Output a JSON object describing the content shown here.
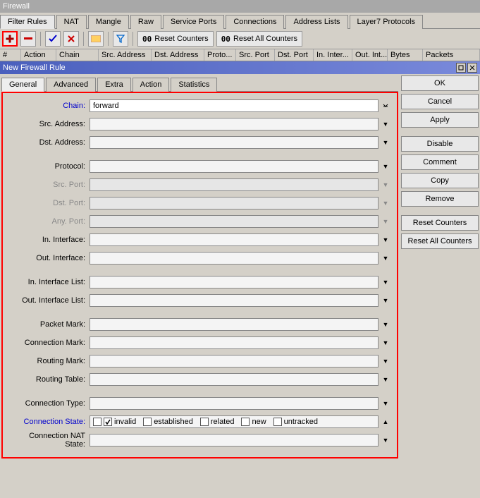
{
  "window_title": "Firewall",
  "main_tabs": [
    "Filter Rules",
    "NAT",
    "Mangle",
    "Raw",
    "Service Ports",
    "Connections",
    "Address Lists",
    "Layer7 Protocols"
  ],
  "toolbar": {
    "reset_counters": "Reset Counters",
    "reset_all_counters": "Reset All Counters"
  },
  "columns": [
    "#",
    "Action",
    "Chain",
    "Src. Address",
    "Dst. Address",
    "Proto...",
    "Src. Port",
    "Dst. Port",
    "In. Inter...",
    "Out. Int...",
    "Bytes",
    "Packets"
  ],
  "dialog": {
    "title": "New Firewall Rule",
    "tabs": [
      "General",
      "Advanced",
      "Extra",
      "Action",
      "Statistics"
    ],
    "fields": {
      "chain": {
        "label": "Chain:",
        "value": "forward"
      },
      "src_address": {
        "label": "Src. Address:",
        "value": ""
      },
      "dst_address": {
        "label": "Dst. Address:",
        "value": ""
      },
      "protocol": {
        "label": "Protocol:",
        "value": ""
      },
      "src_port": {
        "label": "Src. Port:",
        "value": ""
      },
      "dst_port": {
        "label": "Dst. Port:",
        "value": ""
      },
      "any_port": {
        "label": "Any. Port:",
        "value": ""
      },
      "in_interface": {
        "label": "In. Interface:",
        "value": ""
      },
      "out_interface": {
        "label": "Out. Interface:",
        "value": ""
      },
      "in_interface_list": {
        "label": "In. Interface List:",
        "value": ""
      },
      "out_interface_list": {
        "label": "Out. Interface List:",
        "value": ""
      },
      "packet_mark": {
        "label": "Packet Mark:",
        "value": ""
      },
      "connection_mark": {
        "label": "Connection Mark:",
        "value": ""
      },
      "routing_mark": {
        "label": "Routing Mark:",
        "value": ""
      },
      "routing_table": {
        "label": "Routing Table:",
        "value": ""
      },
      "connection_type": {
        "label": "Connection Type:",
        "value": ""
      },
      "connection_state": {
        "label": "Connection State:"
      },
      "connection_nat_state": {
        "label": "Connection NAT State:",
        "value": ""
      }
    },
    "connection_states": {
      "invalid": {
        "label": "invalid",
        "checked": true
      },
      "established": {
        "label": "established",
        "checked": false
      },
      "related": {
        "label": "related",
        "checked": false
      },
      "new": {
        "label": "new",
        "checked": false
      },
      "untracked": {
        "label": "untracked",
        "checked": false
      }
    },
    "buttons": [
      "OK",
      "Cancel",
      "Apply",
      "Disable",
      "Comment",
      "Copy",
      "Remove",
      "Reset Counters",
      "Reset All Counters"
    ]
  }
}
